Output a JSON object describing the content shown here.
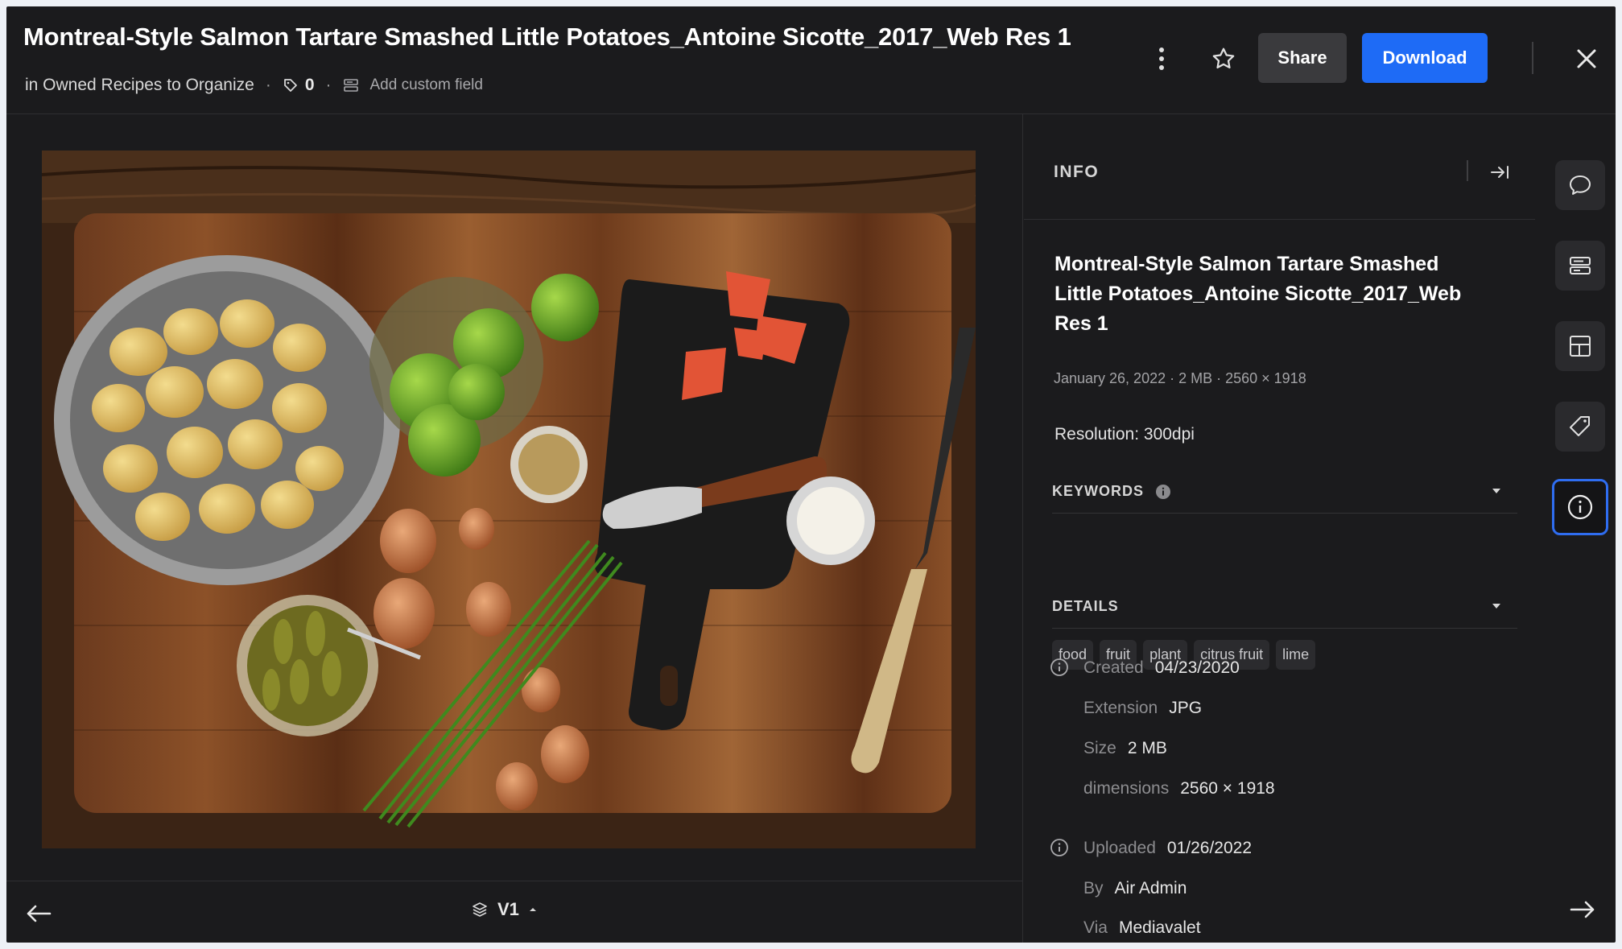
{
  "header": {
    "title": "Montreal-Style Salmon Tartare Smashed Little Potatoes_Antoine Sicotte_2017_Web Res 1",
    "location": "in Owned Recipes to Organize",
    "tag_count": "0",
    "add_custom_field": "Add custom field",
    "share_label": "Share",
    "download_label": "Download"
  },
  "viewer": {
    "version_label": "V1"
  },
  "panel": {
    "heading": "INFO",
    "asset_title": "Montreal-Style Salmon Tartare Smashed Little Potatoes_Antoine Sicotte_2017_Web Res 1",
    "asset_meta": "January 26, 2022 · 2 MB · 2560 × 1918",
    "resolution": "Resolution: 300dpi",
    "keywords_label": "KEYWORDS",
    "keywords": [
      "food",
      "fruit",
      "plant",
      "citrus fruit",
      "lime"
    ],
    "details_label": "DETAILS",
    "details": {
      "created_key": "Created",
      "created_val": "04/23/2020",
      "extension_key": "Extension",
      "extension_val": "JPG",
      "size_key": "Size",
      "size_val": "2 MB",
      "dimensions_key": "dimensions",
      "dimensions_val": "2560 × 1918",
      "uploaded_key": "Uploaded",
      "uploaded_val": "01/26/2022",
      "by_key": "By",
      "by_val": "Air Admin",
      "via_key": "Via",
      "via_val": "Mediavalet"
    }
  },
  "rail": [
    "comment-icon",
    "custom-fields-icon",
    "layout-icon",
    "tag-icon",
    "info-icon"
  ],
  "colors": {
    "accent": "#1e6bf6",
    "background": "#1b1b1d"
  }
}
